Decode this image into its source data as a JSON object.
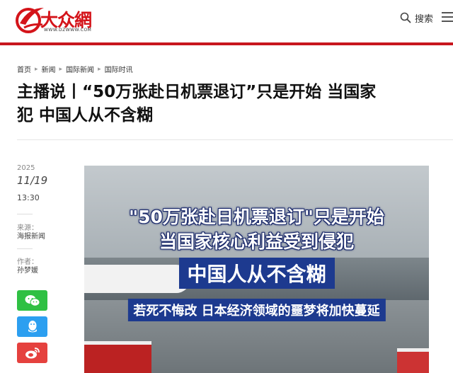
{
  "site": {
    "logo_text": "大众網",
    "logo_url": "WWW.DZWWW.COM",
    "brand_color": "#d4141a"
  },
  "header": {
    "search_label": "搜索",
    "search_icon": "search-icon",
    "menu_icon": "hamburger-menu-icon"
  },
  "breadcrumb": [
    "首页",
    "新闻",
    "国际新闻",
    "国际时讯"
  ],
  "article": {
    "title_line1": "主播说丨“50万张赴日机票退订”只是开始 当国家",
    "title_line2": "犯 中国人从不含糊",
    "year": "2025",
    "date": "11/19",
    "time": "13:30",
    "source_label": "来源：",
    "source": "海报新闻",
    "author_label": "作者：",
    "author": "孙梦媛"
  },
  "share": {
    "wechat_icon": "wechat-icon",
    "qq_icon": "qq-icon",
    "weibo_icon": "weibo-icon",
    "wechat_color": "#2fc043",
    "qq_color": "#2c9ff0",
    "weibo_color": "#e5413e"
  },
  "video": {
    "caption1": "\"50万张赴日机票退订\"只是开始",
    "caption2": "当国家核心利益受到侵犯",
    "caption3": "中国人从不含糊",
    "caption4": "若死不悔改 日本经济领域的噩梦将加快蔓延"
  }
}
